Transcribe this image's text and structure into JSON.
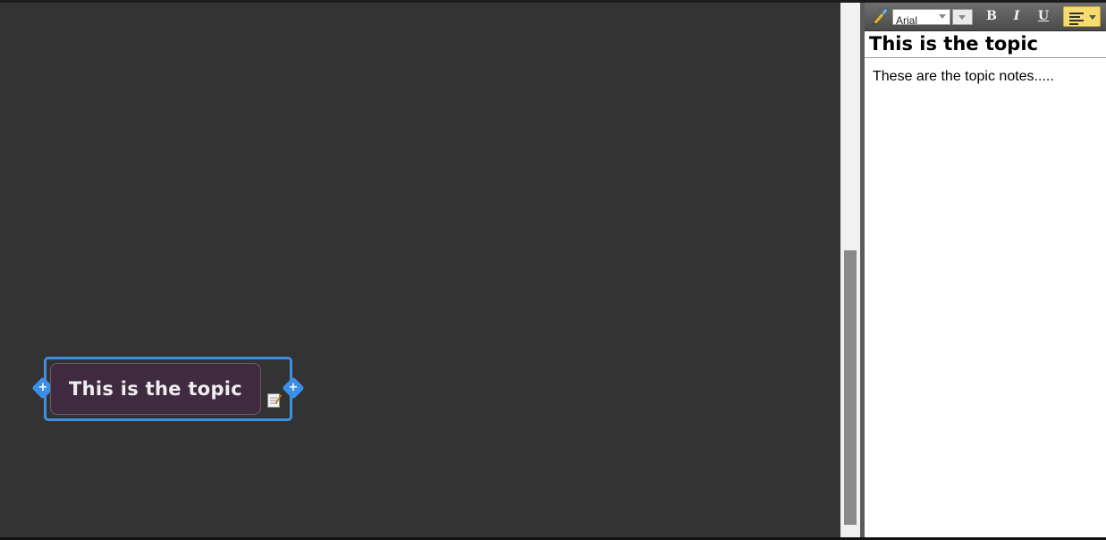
{
  "canvas": {
    "topic": {
      "label": "This is the topic",
      "left_handle_icon": "plus-icon",
      "right_handle_icon": "plus-icon",
      "notes_indicator_icon": "notes-icon"
    },
    "colors": {
      "background": "#333333",
      "topic_fill": "#3f2a40",
      "selection": "#3d8fe6"
    }
  },
  "notes_panel": {
    "toolbar": {
      "clear_format_icon": "brush-icon",
      "font_family": "Arial",
      "bold_label": "B",
      "italic_label": "I",
      "underline_label": "U",
      "align_icon": "align-left-icon"
    },
    "title": "This is the topic",
    "body": "These are the topic notes....."
  }
}
